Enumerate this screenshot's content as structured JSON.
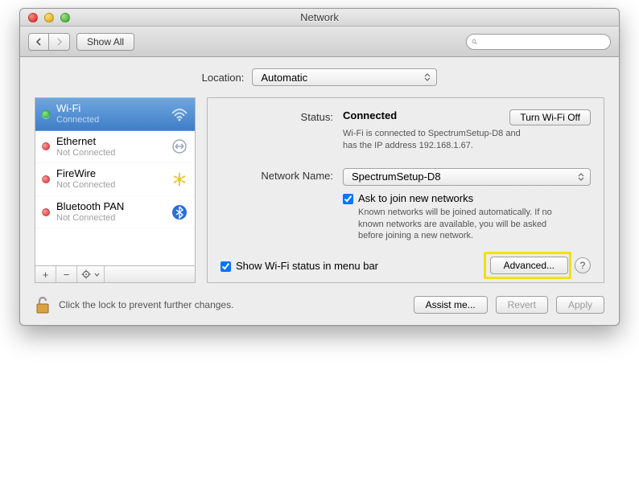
{
  "window": {
    "title": "Network"
  },
  "toolbar": {
    "show_all": "Show All",
    "search_placeholder": ""
  },
  "location": {
    "label": "Location:",
    "value": "Automatic"
  },
  "sidebar": {
    "items": [
      {
        "name": "Wi-Fi",
        "status": "Connected",
        "dot": "green"
      },
      {
        "name": "Ethernet",
        "status": "Not Connected",
        "dot": "red"
      },
      {
        "name": "FireWire",
        "status": "Not Connected",
        "dot": "red"
      },
      {
        "name": "Bluetooth PAN",
        "status": "Not Connected",
        "dot": "red"
      }
    ],
    "footer": {
      "add": "+",
      "remove": "−",
      "gear": "✻▾"
    }
  },
  "details": {
    "status_label": "Status:",
    "status_value": "Connected",
    "turn_off": "Turn Wi-Fi Off",
    "status_desc": "Wi-Fi is connected to SpectrumSetup-D8 and has the IP address 192.168.1.67.",
    "network_name_label": "Network Name:",
    "network_name_value": "SpectrumSetup-D8",
    "ask_join": "Ask to join new networks",
    "ask_join_desc": "Known networks will be joined automatically. If no known networks are available, you will be asked before joining a new network.",
    "show_menubar": "Show Wi-Fi status in menu bar",
    "advanced": "Advanced...",
    "help": "?"
  },
  "footer": {
    "lock_msg": "Click the lock to prevent further changes.",
    "assist": "Assist me...",
    "revert": "Revert",
    "apply": "Apply"
  }
}
